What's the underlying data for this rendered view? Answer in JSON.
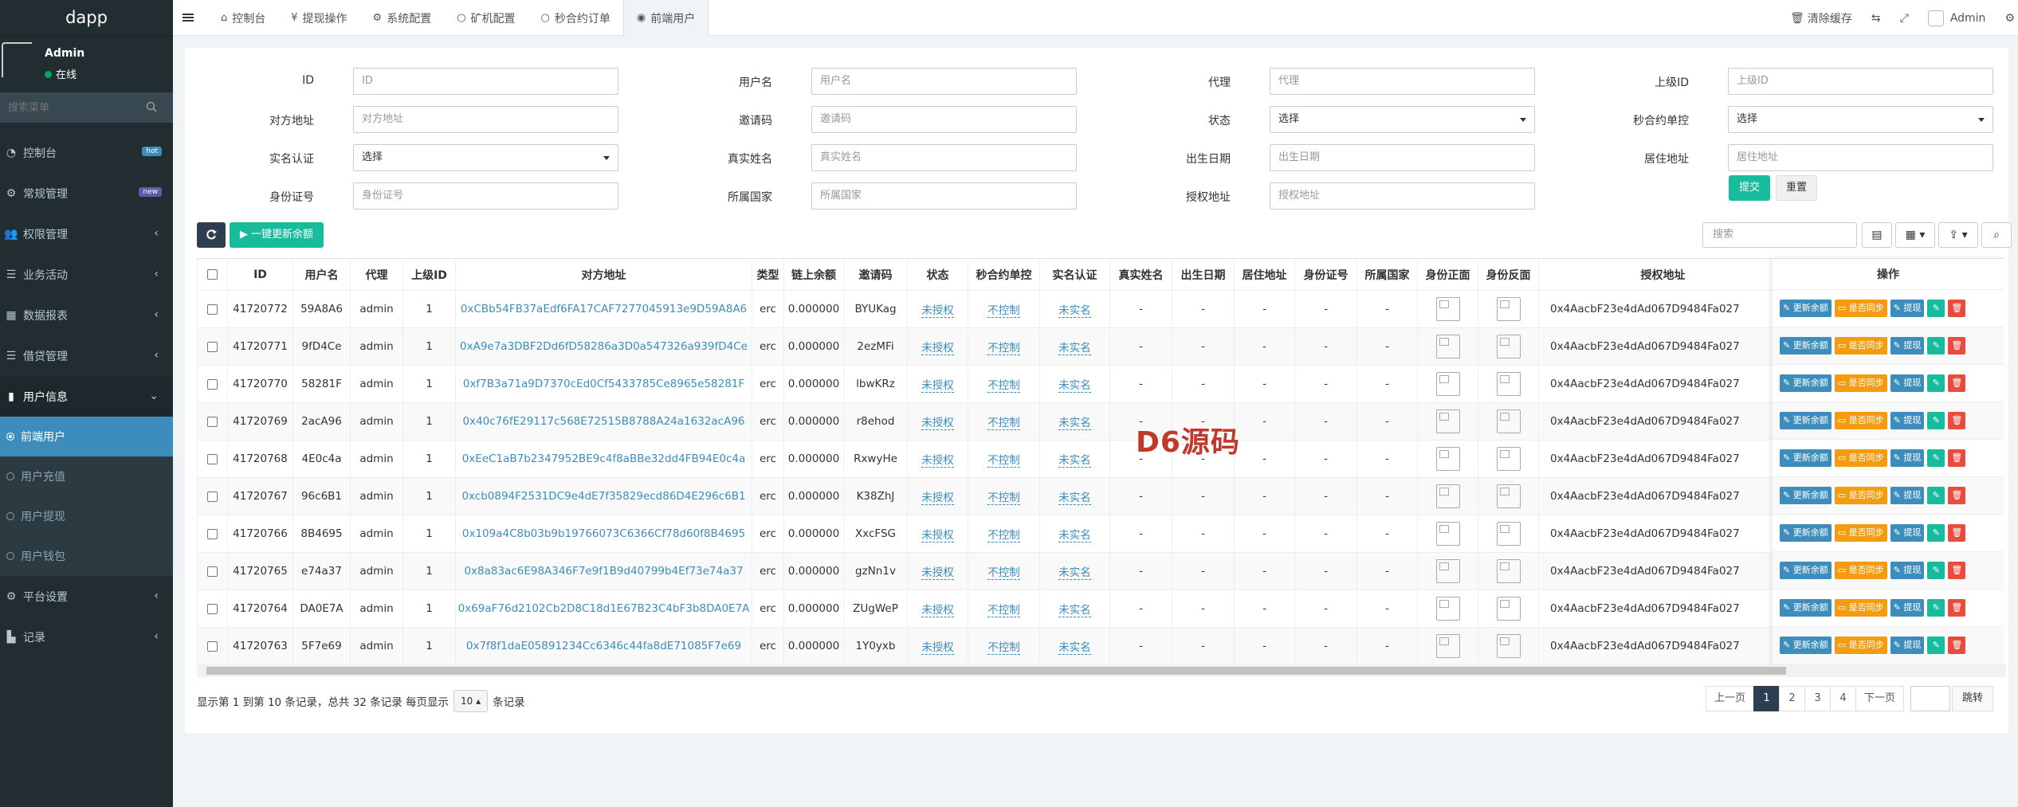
{
  "sidebar": {
    "brand": "dapp",
    "user": {
      "name": "Admin",
      "status": "在线"
    },
    "search_placeholder": "搜索菜单",
    "menu": [
      {
        "label": "控制台",
        "icon": "dashboard-icon",
        "badge": "hot"
      },
      {
        "label": "常规管理",
        "icon": "cogs-icon",
        "badge": "new"
      },
      {
        "label": "权限管理",
        "icon": "group-icon",
        "arrow": "‹"
      },
      {
        "label": "业务活动",
        "icon": "list-icon",
        "arrow": "‹"
      },
      {
        "label": "数据报表",
        "icon": "table-icon",
        "arrow": "‹"
      },
      {
        "label": "借贷管理",
        "icon": "list-icon",
        "arrow": "‹"
      },
      {
        "label": "用户信息",
        "icon": "book-icon",
        "arrow": "⌄"
      }
    ],
    "submenu": [
      {
        "label": "前端用户"
      },
      {
        "label": "用户充值"
      },
      {
        "label": "用户提现"
      },
      {
        "label": "用户钱包"
      }
    ],
    "menu_after": [
      {
        "label": "平台设置",
        "icon": "cog-icon",
        "arrow": "‹"
      },
      {
        "label": "记录",
        "icon": "chart-icon",
        "arrow": "‹"
      }
    ]
  },
  "topbar": {
    "tabs": [
      {
        "label": "控制台",
        "icon": "⌂"
      },
      {
        "label": "提现操作",
        "icon": "¥"
      },
      {
        "label": "系统配置",
        "icon": "⚙"
      },
      {
        "label": "矿机配置",
        "icon": "○"
      },
      {
        "label": "秒合约订单",
        "icon": "○"
      },
      {
        "label": "前端用户",
        "icon": "◉"
      }
    ],
    "clear_cache": "清除缓存",
    "user": "Admin"
  },
  "filter": {
    "fields": [
      {
        "label": "ID",
        "placeholder": "ID",
        "type": "input"
      },
      {
        "label": "用户名",
        "placeholder": "用户名",
        "type": "input"
      },
      {
        "label": "代理",
        "placeholder": "代理",
        "type": "input"
      },
      {
        "label": "上级ID",
        "placeholder": "上级ID",
        "type": "input"
      },
      {
        "label": "对方地址",
        "placeholder": "对方地址",
        "type": "input"
      },
      {
        "label": "邀请码",
        "placeholder": "邀请码",
        "type": "input"
      },
      {
        "label": "状态",
        "placeholder": "选择",
        "type": "select"
      },
      {
        "label": "秒合约单控",
        "placeholder": "选择",
        "type": "select"
      },
      {
        "label": "实名认证",
        "placeholder": "选择",
        "type": "select"
      },
      {
        "label": "真实姓名",
        "placeholder": "真实姓名",
        "type": "input"
      },
      {
        "label": "出生日期",
        "placeholder": "出生日期",
        "type": "input"
      },
      {
        "label": "居住地址",
        "placeholder": "居住地址",
        "type": "input"
      },
      {
        "label": "身份证号",
        "placeholder": "身份证号",
        "type": "input"
      },
      {
        "label": "所属国家",
        "placeholder": "所属国家",
        "type": "input"
      },
      {
        "label": "授权地址",
        "placeholder": "授权地址",
        "type": "input"
      }
    ],
    "submit": "提交",
    "reset": "重置"
  },
  "toolbar": {
    "update_all": "▶ 一键更新余额",
    "search_placeholder": "搜索"
  },
  "table": {
    "headers": [
      "ID",
      "用户名",
      "代理",
      "上级ID",
      "对方地址",
      "类型",
      "链上余额",
      "邀请码",
      "状态",
      "秒合约单控",
      "实名认证",
      "真实姓名",
      "出生日期",
      "居住地址",
      "身份证号",
      "所属国家",
      "身份正面",
      "身份反面",
      "授权地址"
    ],
    "ops_header": "操作",
    "rows": [
      {
        "id": "41720772",
        "username": "59A8A6",
        "agent": "admin",
        "parent": "1",
        "address": "0xCBb54FB37aEdf6FA17CAF7277045913e9D59A8A6",
        "type": "erc",
        "balance": "0.000000",
        "invite": "BYUKag",
        "status": "未授权",
        "control": "不控制",
        "realname_auth": "未实名",
        "realname": "-",
        "birth": "-",
        "residence": "-",
        "idno": "-",
        "country": "-",
        "auth_addr": "0x4AacbF23e4dAd067D9484Fa027"
      },
      {
        "id": "41720771",
        "username": "9fD4Ce",
        "agent": "admin",
        "parent": "1",
        "address": "0xA9e7a3DBF2Dd6fD58286a3D0a547326a939fD4Ce",
        "type": "erc",
        "balance": "0.000000",
        "invite": "2ezMFi",
        "status": "未授权",
        "control": "不控制",
        "realname_auth": "未实名",
        "realname": "-",
        "birth": "-",
        "residence": "-",
        "idno": "-",
        "country": "-",
        "auth_addr": "0x4AacbF23e4dAd067D9484Fa027"
      },
      {
        "id": "41720770",
        "username": "58281F",
        "agent": "admin",
        "parent": "1",
        "address": "0xf7B3a71a9D7370cEd0Cf5433785Ce8965e58281F",
        "type": "erc",
        "balance": "0.000000",
        "invite": "lbwKRz",
        "status": "未授权",
        "control": "不控制",
        "realname_auth": "未实名",
        "realname": "-",
        "birth": "-",
        "residence": "-",
        "idno": "-",
        "country": "-",
        "auth_addr": "0x4AacbF23e4dAd067D9484Fa027"
      },
      {
        "id": "41720769",
        "username": "2acA96",
        "agent": "admin",
        "parent": "1",
        "address": "0x40c76fE29117c568E72515B8788A24a1632acA96",
        "type": "erc",
        "balance": "0.000000",
        "invite": "r8ehod",
        "status": "未授权",
        "control": "不控制",
        "realname_auth": "未实名",
        "realname": "-",
        "birth": "-",
        "residence": "-",
        "idno": "-",
        "country": "-",
        "auth_addr": "0x4AacbF23e4dAd067D9484Fa027"
      },
      {
        "id": "41720768",
        "username": "4E0c4a",
        "agent": "admin",
        "parent": "1",
        "address": "0xEeC1aB7b2347952BE9c4f8aBBe32dd4FB94E0c4a",
        "type": "erc",
        "balance": "0.000000",
        "invite": "RxwyHe",
        "status": "未授权",
        "control": "不控制",
        "realname_auth": "未实名",
        "realname": "-",
        "birth": "-",
        "residence": "-",
        "idno": "-",
        "country": "-",
        "auth_addr": "0x4AacbF23e4dAd067D9484Fa027"
      },
      {
        "id": "41720767",
        "username": "96c6B1",
        "agent": "admin",
        "parent": "1",
        "address": "0xcb0894F2531DC9e4dE7f35829ecd86D4E296c6B1",
        "type": "erc",
        "balance": "0.000000",
        "invite": "K38ZhJ",
        "status": "未授权",
        "control": "不控制",
        "realname_auth": "未实名",
        "realname": "-",
        "birth": "-",
        "residence": "-",
        "idno": "-",
        "country": "-",
        "auth_addr": "0x4AacbF23e4dAd067D9484Fa027"
      },
      {
        "id": "41720766",
        "username": "8B4695",
        "agent": "admin",
        "parent": "1",
        "address": "0x109a4C8b03b9b19766073C6366Cf78d60f8B4695",
        "type": "erc",
        "balance": "0.000000",
        "invite": "XxcFSG",
        "status": "未授权",
        "control": "不控制",
        "realname_auth": "未实名",
        "realname": "-",
        "birth": "-",
        "residence": "-",
        "idno": "-",
        "country": "-",
        "auth_addr": "0x4AacbF23e4dAd067D9484Fa027"
      },
      {
        "id": "41720765",
        "username": "e74a37",
        "agent": "admin",
        "parent": "1",
        "address": "0x8a83ac6E98A346F7e9f1B9d40799b4Ef73e74a37",
        "type": "erc",
        "balance": "0.000000",
        "invite": "gzNn1v",
        "status": "未授权",
        "control": "不控制",
        "realname_auth": "未实名",
        "realname": "-",
        "birth": "-",
        "residence": "-",
        "idno": "-",
        "country": "-",
        "auth_addr": "0x4AacbF23e4dAd067D9484Fa027"
      },
      {
        "id": "41720764",
        "username": "DA0E7A",
        "agent": "admin",
        "parent": "1",
        "address": "0x69aF76d2102Cb2D8C18d1E67B23C4bF3b8DA0E7A",
        "type": "erc",
        "balance": "0.000000",
        "invite": "ZUgWeP",
        "status": "未授权",
        "control": "不控制",
        "realname_auth": "未实名",
        "realname": "-",
        "birth": "-",
        "residence": "-",
        "idno": "-",
        "country": "-",
        "auth_addr": "0x4AacbF23e4dAd067D9484Fa027"
      },
      {
        "id": "41720763",
        "username": "5F7e69",
        "agent": "admin",
        "parent": "1",
        "address": "0x7f8f1daE05891234Cc6346c44fa8dE71085F7e69",
        "type": "erc",
        "balance": "0.000000",
        "invite": "1Y0yxb",
        "status": "未授权",
        "control": "不控制",
        "realname_auth": "未实名",
        "realname": "-",
        "birth": "-",
        "residence": "-",
        "idno": "-",
        "country": "-",
        "auth_addr": "0x4AacbF23e4dAd067D9484Fa027"
      }
    ],
    "ops": {
      "update_balance": "更新余额",
      "sync": "是否同步",
      "withdraw": "提现"
    }
  },
  "pagination": {
    "info_prefix": "显示第 1 到第 10 条记录，总共 32 条记录 每页显示",
    "per_page": "10 ▴",
    "info_suffix": "条记录",
    "prev": "上一页",
    "pages": [
      "1",
      "2",
      "3",
      "4"
    ],
    "next": "下一页",
    "jump": "跳转"
  },
  "watermark": "D6源码",
  "colors": {
    "sidebar_bg": "#222d32",
    "active_blue": "#3c8dbc",
    "success_green": "#18bc9c",
    "warning_orange": "#f39c12",
    "danger_red": "#e74c3c",
    "dark_navy": "#2c3e50"
  }
}
